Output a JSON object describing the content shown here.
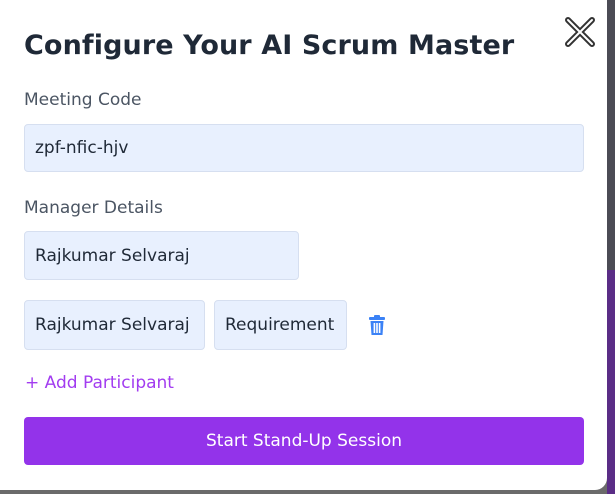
{
  "modal": {
    "title": "Configure Your AI Scrum Master",
    "close_icon": "close-icon"
  },
  "meeting": {
    "label": "Meeting Code",
    "code_value": "zpf-nfic-hjv"
  },
  "manager": {
    "label": "Manager Details",
    "name_value": "Rajkumar Selvaraj"
  },
  "participants": [
    {
      "name_value": "Rajkumar Selvaraj",
      "role_value": "Requirement",
      "delete_icon": "trash-icon"
    }
  ],
  "actions": {
    "add_participant_label": "+ Add Participant",
    "start_session_label": "Start Stand-Up Session"
  },
  "colors": {
    "accent": "#9333ea",
    "link": "#a23cf0",
    "input_bg": "#e8f0fe",
    "trash": "#3b82f6",
    "title": "#1f2937"
  }
}
